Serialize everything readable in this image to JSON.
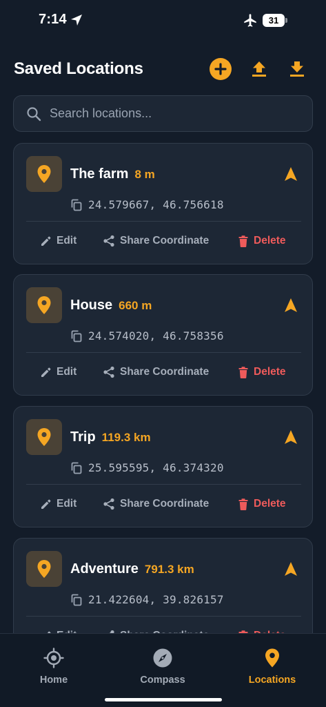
{
  "status_bar": {
    "time": "7:14",
    "battery": "31"
  },
  "header": {
    "title": "Saved Locations"
  },
  "search": {
    "placeholder": "Search locations..."
  },
  "actions": {
    "edit": "Edit",
    "share": "Share Coordinate",
    "delete": "Delete"
  },
  "locations": [
    {
      "name": "The farm",
      "distance": "8 m",
      "coords": "24.579667, 46.756618"
    },
    {
      "name": "House",
      "distance": "660 m",
      "coords": "24.574020, 46.758356"
    },
    {
      "name": "Trip",
      "distance": "119.3 km",
      "coords": "25.595595, 46.374320"
    },
    {
      "name": "Adventure",
      "distance": "791.3 km",
      "coords": "21.422604, 39.826157"
    }
  ],
  "tabs": [
    {
      "label": "Home",
      "icon": "crosshair-icon"
    },
    {
      "label": "Compass",
      "icon": "compass-icon"
    },
    {
      "label": "Locations",
      "icon": "map-pin-icon",
      "active": true
    }
  ],
  "colors": {
    "accent": "#f5a623",
    "danger": "#ef5b5b",
    "background": "#131c29",
    "card": "#1d2735"
  }
}
